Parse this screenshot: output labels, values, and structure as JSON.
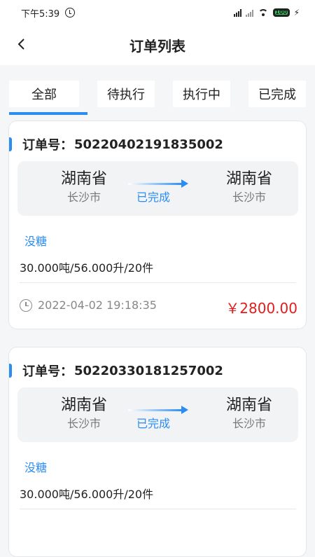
{
  "status_bar": {
    "time": "下午5:39",
    "battery": "100"
  },
  "header": {
    "title": "订单列表"
  },
  "tabs": [
    {
      "label": "全部",
      "active": true
    },
    {
      "label": "待执行",
      "active": false
    },
    {
      "label": "执行中",
      "active": false
    },
    {
      "label": "已完成",
      "active": false
    }
  ],
  "orders": [
    {
      "order_label": "订单号：",
      "order_no": "50220402191835002",
      "from_province": "湖南省",
      "from_city": "长沙市",
      "status": "已完成",
      "to_province": "湖南省",
      "to_city": "长沙市",
      "goods": "没糖",
      "spec": "30.000吨/56.000升/20件",
      "time": "2022-04-02 19:18:35",
      "price": "￥2800.00"
    },
    {
      "order_label": "订单号：",
      "order_no": "50220330181257002",
      "from_province": "湖南省",
      "from_city": "长沙市",
      "status": "已完成",
      "to_province": "湖南省",
      "to_city": "长沙市",
      "goods": "没糖",
      "spec": "30.000吨/56.000升/20件"
    }
  ],
  "colors": {
    "accent": "#2b8df2",
    "price": "#e11d1d",
    "background": "#f5f6f8"
  },
  "icons": {
    "back": "back-icon",
    "clock": "clock-icon",
    "alarm": "alarm-icon",
    "wifi": "wifi-icon",
    "battery": "battery-icon"
  }
}
